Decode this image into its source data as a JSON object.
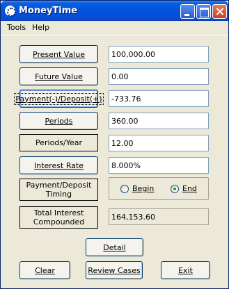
{
  "window": {
    "title": "MoneyTime"
  },
  "menu": {
    "tools": "Tools",
    "help": "Help"
  },
  "rows": {
    "present_value": {
      "label": "Present Value",
      "value": "100,000.00"
    },
    "future_value": {
      "label": "Future Value",
      "value": "0.00"
    },
    "payment": {
      "label": "Payment(-)/Deposit(+)",
      "value": "-733.76"
    },
    "periods": {
      "label": "Periods",
      "value": "360.00"
    },
    "periods_per_year": {
      "label": "Periods/Year",
      "value": "12.00"
    },
    "interest_rate": {
      "label": "Interest Rate",
      "value": "8.000%"
    },
    "timing": {
      "label_line1": "Payment/Deposit",
      "label_line2": "Timing",
      "begin": "Begin",
      "end": "End",
      "selected": "End"
    },
    "total_interest": {
      "label_line1": "Total Interest",
      "label_line2": "Compounded",
      "value": "164,153.60"
    }
  },
  "buttons": {
    "detail": "Detail",
    "clear": "Clear",
    "review_cases": "Review Cases",
    "exit": "Exit"
  },
  "icons": {
    "app": "money-time-icon",
    "minimize": "minimize-icon",
    "maximize": "maximize-icon",
    "close": "close-icon"
  }
}
